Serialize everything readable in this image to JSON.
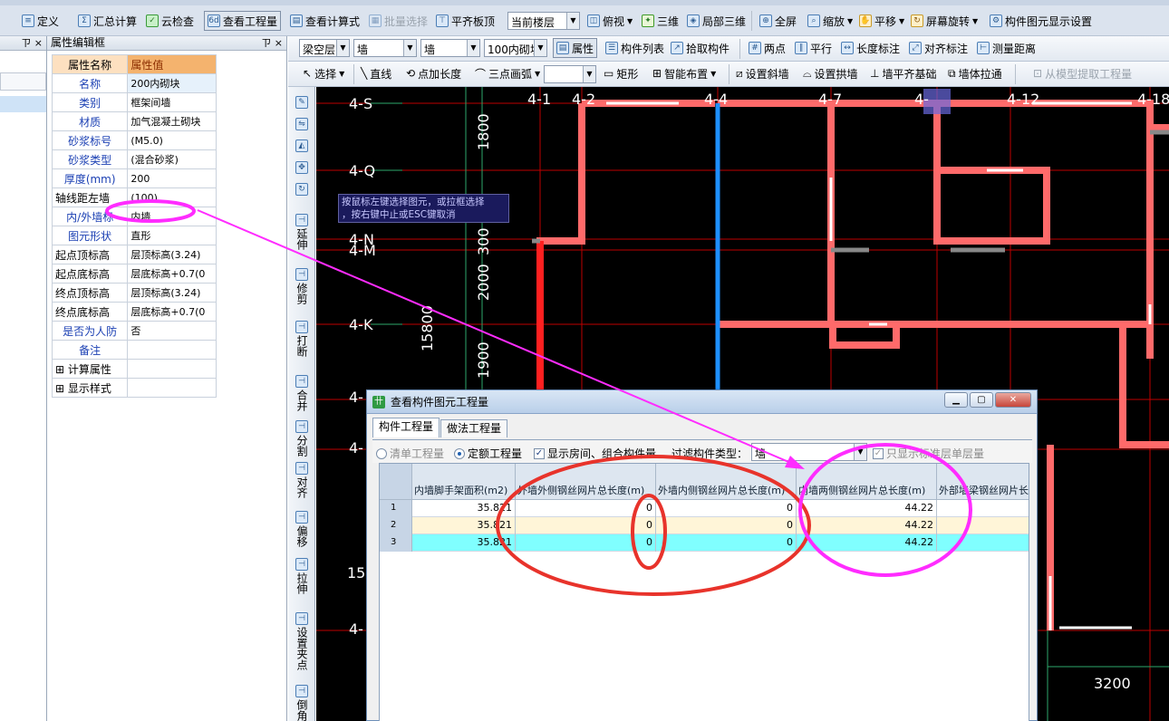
{
  "toolbar1": {
    "define": "定义",
    "summary_calc": "汇总计算",
    "cloud_check": "云检查",
    "view_quantity": "查看工程量",
    "view_formula": "查看计算式",
    "batch_select": "批量选择",
    "flat_slab": "平齐板顶",
    "floor_select": "当前楼层",
    "top_view": "俯视",
    "three_d": "三维",
    "local_3d": "局部三维",
    "full_screen": "全屏",
    "zoom": "缩放",
    "pan": "平移",
    "rotate": "屏幕旋转",
    "display_settings": "构件图元显示设置"
  },
  "toolbar2": {
    "layer": "梁空层",
    "type1": "墙",
    "type2": "墙",
    "component": "100内砌块",
    "properties": "属性",
    "component_list": "构件列表",
    "pick_component": "拾取构件",
    "two_points": "两点",
    "parallel": "平行",
    "length_dim": "长度标注",
    "align_dim": "对齐标注",
    "measure_distance": "测量距离"
  },
  "toolbar3": {
    "select": "选择",
    "line": "直线",
    "point_length": "点加长度",
    "three_point_arc": "三点画弧",
    "rectangle": "矩形",
    "smart_layout": "智能布置",
    "set_slope_wall": "设置斜墙",
    "set_arch_wall": "设置拱墙",
    "wall_align_foundation": "墙平齐基础",
    "wall_pull": "墙体拉通",
    "extract_from_model": "从模型提取工程量"
  },
  "property_panel": {
    "title": "属性编辑框",
    "pin": "ㄗ ×",
    "col_name": "属性名称",
    "col_value": "属性值",
    "rows": [
      {
        "name": "名称",
        "value": "200内砌块",
        "blue": true
      },
      {
        "name": "类别",
        "value": "框架间墙",
        "blue": true
      },
      {
        "name": "材质",
        "value": "加气混凝土砌块",
        "blue": true
      },
      {
        "name": "砂浆标号",
        "value": "(M5.0)",
        "blue": true
      },
      {
        "name": "砂浆类型",
        "value": "(混合砂浆)",
        "blue": true
      },
      {
        "name": "厚度(mm)",
        "value": "200",
        "blue": true
      },
      {
        "name": "轴线距左墙",
        "value": "(100)",
        "blue": false
      },
      {
        "name": "内/外墙标",
        "value": "内墙",
        "blue": true
      },
      {
        "name": "图元形状",
        "value": "直形",
        "blue": true
      },
      {
        "name": "起点顶标高",
        "value": "层顶标高(3.24)",
        "blue": false
      },
      {
        "name": "起点底标高",
        "value": "层底标高+0.7(0",
        "blue": false
      },
      {
        "name": "终点顶标高",
        "value": "层顶标高(3.24)",
        "blue": false
      },
      {
        "name": "终点底标高",
        "value": "层底标高+0.7(0",
        "blue": false
      },
      {
        "name": "是否为人防",
        "value": "否",
        "blue": true
      },
      {
        "name": "备注",
        "value": "",
        "blue": true
      },
      {
        "name": "计算属性",
        "value": "",
        "blue": false,
        "expand": true
      },
      {
        "name": "显示样式",
        "value": "",
        "blue": false,
        "expand": true
      }
    ]
  },
  "left_pane": {
    "pin": "ㄗ ×"
  },
  "vtools": [
    "延伸",
    "修剪",
    "打断",
    "合并",
    "分割",
    "对齐",
    "偏移",
    "拉伸",
    "设置夹点",
    "倒角"
  ],
  "canvas": {
    "axis_labels": [
      "4-S",
      "4-Q",
      "4-N",
      "4-M",
      "4-K",
      "4-",
      "4-",
      "4-"
    ],
    "top_labels": [
      "4-1",
      "4-2",
      "4-4",
      "4-7",
      "4-",
      "4-12",
      "4-18"
    ],
    "dims_vertical": [
      "1800",
      "300",
      "2000",
      "1900",
      "15800"
    ],
    "dim_bottom": "3200",
    "dim_left": "15",
    "tooltip": "按鼠标左键选择图元，或拉框选择\n，按右键中止或ESC键取消"
  },
  "dialog": {
    "title": "查看构件图元工程量",
    "tabs": [
      "构件工程量",
      "做法工程量"
    ],
    "opt_list": "清单工程量",
    "opt_quota": "定额工程量",
    "opt_show_rooms": "显示房间、组合构件量",
    "filter_label": "过滤构件类型：",
    "filter_value": "墙",
    "opt_std_floor": "只显示标准层单层量",
    "columns": [
      "内墙脚手架面积(m2)",
      "外墙外侧钢丝网片总长度(m)",
      "外墙内侧钢丝网片总长度(m)",
      "内墙两侧钢丝网片总长度(m)",
      "外部墙梁钢丝网片长"
    ],
    "rows": [
      {
        "n": "1",
        "cells": [
          "35.821",
          "0",
          "0",
          "44.22",
          ""
        ]
      },
      {
        "n": "2",
        "cells": [
          "35.821",
          "0",
          "0",
          "44.22",
          ""
        ]
      },
      {
        "n": "3",
        "cells": [
          "35.821",
          "0",
          "0",
          "44.22",
          ""
        ]
      }
    ]
  },
  "colors": {
    "wall_red": "#ff5a5a",
    "wall_pink": "#ff8a8a",
    "annotation_magenta": "#ff2cff",
    "annotation_red": "#e8332b",
    "grid_green": "#2ea86b",
    "selected_row": "#80ffff",
    "alt_row": "#fff5d8"
  }
}
